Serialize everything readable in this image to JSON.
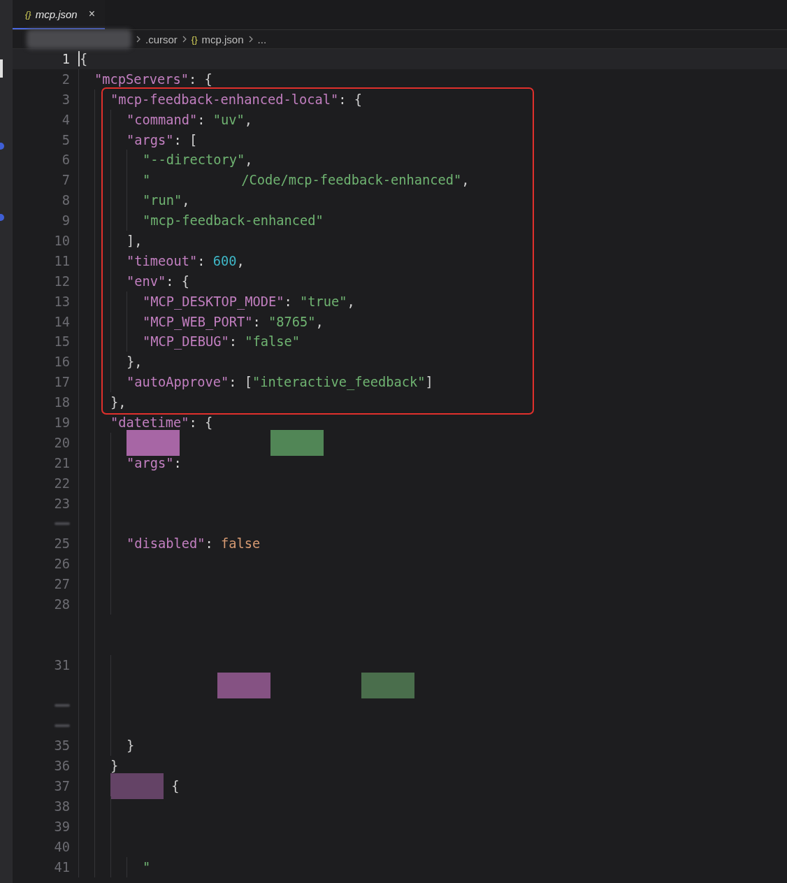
{
  "tab": {
    "icon": "{}",
    "label": "mcp.json",
    "close": "×",
    "selected": true
  },
  "breadcrumb": [
    {
      "kind": "redacted"
    },
    {
      "kind": "text",
      "label": ".cursor"
    },
    {
      "kind": "file",
      "icon": "{}",
      "label": "mcp.json"
    },
    {
      "kind": "text",
      "label": "..."
    }
  ],
  "lines": [
    {
      "number": "1",
      "current": true,
      "tokens": [
        {
          "kind": "punct",
          "text": "{"
        }
      ],
      "children": [
        {
          "number": "2",
          "tokens": [
            {
              "kind": "key",
              "text": "\"mcpServers\""
            },
            {
              "kind": "punct",
              "text": ": {"
            }
          ],
          "children": [
            {
              "number": "3",
              "highlighted": true,
              "tokens": [
                {
                  "kind": "key",
                  "text": "\"mcp-feedback-enhanced-local\""
                },
                {
                  "kind": "punct",
                  "text": ": {"
                }
              ],
              "children": [
                {
                  "number": "4",
                  "tokens": [
                    {
                      "kind": "key",
                      "text": "\"command\""
                    },
                    {
                      "kind": "punct",
                      "text": ": "
                    },
                    {
                      "kind": "string",
                      "text": "\"uv\""
                    },
                    {
                      "kind": "punct",
                      "text": ","
                    }
                  ]
                },
                {
                  "number": "5",
                  "tokens": [
                    {
                      "kind": "key",
                      "text": "\"args\""
                    },
                    {
                      "kind": "punct",
                      "text": ": ["
                    }
                  ],
                  "children": [
                    {
                      "number": "6",
                      "tokens": [
                        {
                          "kind": "string",
                          "text": "\"--directory\""
                        },
                        {
                          "kind": "punct",
                          "text": ","
                        }
                      ]
                    },
                    {
                      "number": "7",
                      "tokens": [
                        {
                          "kind": "string",
                          "text": "\""
                        },
                        {
                          "kind": "gap"
                        },
                        {
                          "kind": "string",
                          "text": "/Code/mcp-feedback-enhanced\""
                        },
                        {
                          "kind": "punct",
                          "text": ","
                        }
                      ]
                    },
                    {
                      "number": "8",
                      "tokens": [
                        {
                          "kind": "string",
                          "text": "\"run\""
                        },
                        {
                          "kind": "punct",
                          "text": ","
                        }
                      ]
                    },
                    {
                      "number": "9",
                      "tokens": [
                        {
                          "kind": "string",
                          "text": "\"mcp-feedback-enhanced\""
                        }
                      ]
                    }
                  ],
                  "closing": {
                    "number": "10",
                    "tokens": [
                      {
                        "kind": "punct",
                        "text": "],"
                      }
                    ]
                  }
                },
                {
                  "number": "11",
                  "tokens": [
                    {
                      "kind": "key",
                      "text": "\"timeout\""
                    },
                    {
                      "kind": "punct",
                      "text": ": "
                    },
                    {
                      "kind": "number",
                      "text": "600"
                    },
                    {
                      "kind": "punct",
                      "text": ","
                    }
                  ]
                },
                {
                  "number": "12",
                  "tokens": [
                    {
                      "kind": "key",
                      "text": "\"env\""
                    },
                    {
                      "kind": "punct",
                      "text": ": {"
                    }
                  ],
                  "children": [
                    {
                      "number": "13",
                      "tokens": [
                        {
                          "kind": "key",
                          "text": "\"MCP_DESKTOP_MODE\""
                        },
                        {
                          "kind": "punct",
                          "text": ": "
                        },
                        {
                          "kind": "string",
                          "text": "\"true\""
                        },
                        {
                          "kind": "punct",
                          "text": ","
                        }
                      ]
                    },
                    {
                      "number": "14",
                      "tokens": [
                        {
                          "kind": "key",
                          "text": "\"MCP_WEB_PORT\""
                        },
                        {
                          "kind": "punct",
                          "text": ": "
                        },
                        {
                          "kind": "string",
                          "text": "\"8765\""
                        },
                        {
                          "kind": "punct",
                          "text": ","
                        }
                      ]
                    },
                    {
                      "number": "15",
                      "tokens": [
                        {
                          "kind": "key",
                          "text": "\"MCP_DEBUG\""
                        },
                        {
                          "kind": "punct",
                          "text": ": "
                        },
                        {
                          "kind": "string",
                          "text": "\"false\""
                        }
                      ]
                    }
                  ],
                  "closing": {
                    "number": "16",
                    "tokens": [
                      {
                        "kind": "punct",
                        "text": "},"
                      }
                    ]
                  }
                },
                {
                  "number": "17",
                  "tokens": [
                    {
                      "kind": "key",
                      "text": "\"autoApprove\""
                    },
                    {
                      "kind": "punct",
                      "text": ": ["
                    },
                    {
                      "kind": "string",
                      "text": "\"interactive_feedback\""
                    },
                    {
                      "kind": "punct",
                      "text": "]"
                    }
                  ]
                }
              ],
              "closing": {
                "number": "18",
                "tokens": [
                  {
                    "kind": "punct",
                    "text": "},"
                  }
                ]
              }
            },
            {
              "number": "19",
              "highlighted": false,
              "tokens": [
                {
                  "kind": "key",
                  "text": "\"datetime\""
                },
                {
                  "kind": "punct",
                  "text": ": {"
                }
              ],
              "children": [
                {
                  "number": "20",
                  "tokens": [
                    {
                      "kind": "redacted",
                      "color": "#a766a5"
                    },
                    {
                      "kind": "gap"
                    },
                    {
                      "kind": "redacted",
                      "color": "#518656"
                    }
                  ]
                },
                {
                  "number": "21",
                  "tokens": [
                    {
                      "kind": "key",
                      "text": "\"args\""
                    },
                    {
                      "kind": "punct",
                      "text": ":"
                    }
                  ]
                },
                {
                  "number": "22"
                },
                {
                  "number": "23"
                },
                {
                  "kind": "blank"
                },
                {
                  "number": "25",
                  "tokens": [
                    {
                      "kind": "key",
                      "text": "\"disabled\""
                    },
                    {
                      "kind": "punct",
                      "text": ": "
                    },
                    {
                      "kind": "bool",
                      "text": "false"
                    }
                  ]
                },
                {
                  "number": "26"
                },
                {
                  "number": "27"
                },
                {
                  "number": "28"
                }
              ]
            },
            {
              "highlighted": false
            },
            {
              "highlighted": false,
              "children": [
                {
                  "number": "31"
                },
                {
                  "tokens": [
                    {
                      "kind": "gap"
                    },
                    {
                      "kind": "redacted",
                      "color": "#855283"
                    },
                    {
                      "kind": "gap"
                    },
                    {
                      "kind": "redacted",
                      "color": "#4a6e4c"
                    }
                  ]
                },
                {
                  "kind": "blank"
                },
                {
                  "kind": "blank"
                },
                {
                  "number": "35",
                  "tokens": [
                    {
                      "kind": "punct",
                      "text": "}"
                    }
                  ]
                }
              ]
            },
            {
              "number": "36",
              "highlighted": false,
              "tokens": [
                {
                  "kind": "punct",
                  "text": "}"
                }
              ]
            },
            {
              "number": "37",
              "highlighted": false,
              "tokens": [
                {
                  "kind": "redacted",
                  "color": "#644366"
                },
                {
                  "kind": "punct",
                  "text": " {"
                }
              ],
              "children": [
                {
                  "number": "38"
                },
                {
                  "number": "39"
                },
                {
                  "number": "40",
                  "children": [
                    {
                      "number": "41",
                      "tokens": [
                        {
                          "kind": "string",
                          "text": "\""
                        }
                      ]
                    }
                  ]
                }
              ]
            }
          ]
        }
      ]
    }
  ]
}
